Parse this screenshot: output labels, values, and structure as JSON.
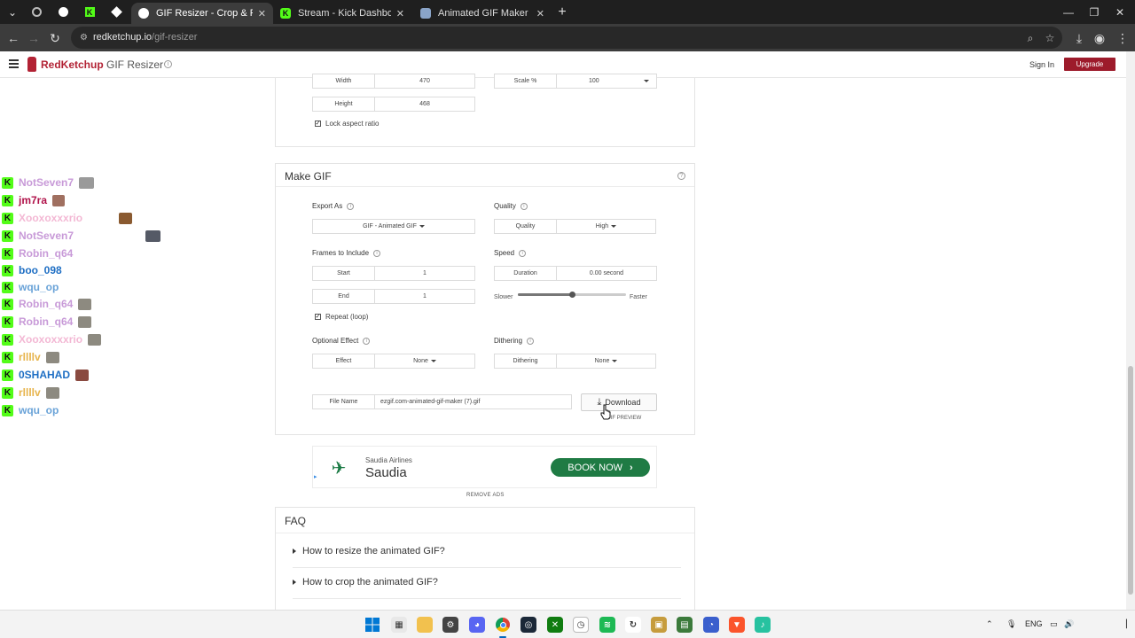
{
  "browser": {
    "tabs": [
      {
        "title": "GIF Resizer - Crop & Resize Ani",
        "active": true
      },
      {
        "title": "Stream - Kick Dashboard",
        "active": false
      },
      {
        "title": "Animated GIF Maker",
        "active": false
      }
    ],
    "url_domain": "redketchup.io",
    "url_path": "/gif-resizer"
  },
  "header": {
    "brand": "RedKetchup",
    "page_name": "GIF Resizer",
    "signin_label": "Sign In",
    "upgrade_label": "Upgrade"
  },
  "resize_card": {
    "width_label": "Width",
    "width_value": "470",
    "height_label": "Height",
    "height_value": "468",
    "scale_label": "Scale %",
    "scale_value": "100",
    "lock_label": "Lock aspect ratio",
    "lock_checked": true
  },
  "make_gif": {
    "title": "Make GIF",
    "export_label": "Export As",
    "export_value": "GIF - Animated GIF",
    "quality_section": "Quality",
    "quality_label": "Quality",
    "quality_value": "High",
    "frames_label": "Frames to Include",
    "start_label": "Start",
    "start_value": "1",
    "end_label": "End",
    "end_value": "1",
    "repeat_label": "Repeat (loop)",
    "repeat_checked": true,
    "speed_section": "Speed",
    "duration_label": "Duration",
    "duration_value": "0.00 second",
    "slower_label": "Slower",
    "faster_label": "Faster",
    "speed_level": 0.5,
    "effect_section": "Optional Effect",
    "effect_label": "Effect",
    "effect_value": "None",
    "dither_section": "Dithering",
    "dither_label": "Dithering",
    "dither_value": "None",
    "filename_label": "File Name",
    "filename_value": "ezgif.com-animated-gif-maker (7).gif",
    "download_label": "Download",
    "preview_label": "GIF PREVIEW"
  },
  "ad": {
    "sub": "Saudia Airlines",
    "main": "Saudia",
    "cta": "BOOK NOW",
    "remove_label": "REMOVE ADS"
  },
  "faq": {
    "title": "FAQ",
    "items": [
      "How to resize the animated GIF?",
      "How to crop the animated GIF?"
    ]
  },
  "chat": [
    {
      "name": "NotSeven7",
      "color": "#c89ad8"
    },
    {
      "name": "jm7ra",
      "color": "#b0124a"
    },
    {
      "name": "Xooxoxxxrio",
      "color": "#f3b8d4"
    },
    {
      "name": "NotSeven7",
      "color": "#c89ad8"
    },
    {
      "name": "Robin_q64",
      "color": "#c89ad8"
    },
    {
      "name": "boo_098",
      "color": "#1f6fc4"
    },
    {
      "name": "wqu_op",
      "color": "#6aa3d8"
    },
    {
      "name": "Robin_q64",
      "color": "#c89ad8"
    },
    {
      "name": "Robin_q64",
      "color": "#c89ad8"
    },
    {
      "name": "Xooxoxxxrio",
      "color": "#f3b8d4"
    },
    {
      "name": "rllllv",
      "color": "#e7b44c"
    },
    {
      "name": "0SHAHAD",
      "color": "#1f6fc4"
    },
    {
      "name": "rllllv",
      "color": "#e7b44c"
    },
    {
      "name": "wqu_op",
      "color": "#6aa3d8"
    }
  ],
  "taskbar": {
    "lang": "ENG"
  }
}
